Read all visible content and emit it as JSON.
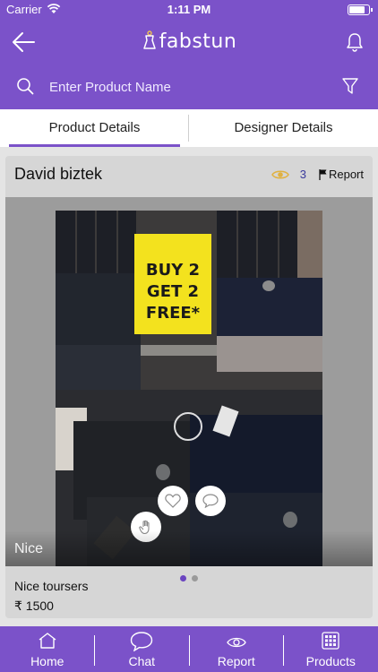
{
  "status_bar": {
    "carrier": "Carrier",
    "time": "1:11 PM"
  },
  "header": {
    "logo_text": "fabstun",
    "back_icon": "arrow-left-icon",
    "bell_icon": "bell-icon"
  },
  "search": {
    "placeholder": "Enter Product Name",
    "filter_icon": "filter-icon"
  },
  "tabs": [
    {
      "label": "Product Details",
      "active": true
    },
    {
      "label": "Designer Details",
      "active": false
    }
  ],
  "product": {
    "designer_name": "David biztek",
    "view_count": "3",
    "report_label": "Report",
    "photo_sign": {
      "line1": "BUY 2",
      "line2": "GET 2",
      "line3": "FREE*"
    },
    "caption": "Nice",
    "title": "Nice toursers",
    "price": "₹ 1500",
    "carousel": {
      "total": 2,
      "active_index": 0
    }
  },
  "bottom_nav": [
    {
      "label": "Home",
      "icon": "home-icon"
    },
    {
      "label": "Chat",
      "icon": "chat-icon"
    },
    {
      "label": "Report",
      "icon": "eye-icon"
    },
    {
      "label": "Products",
      "icon": "grid-icon"
    }
  ],
  "colors": {
    "brand": "#7b52c9",
    "accent_eye": "#e0b13f",
    "count": "#3a3a9c"
  }
}
